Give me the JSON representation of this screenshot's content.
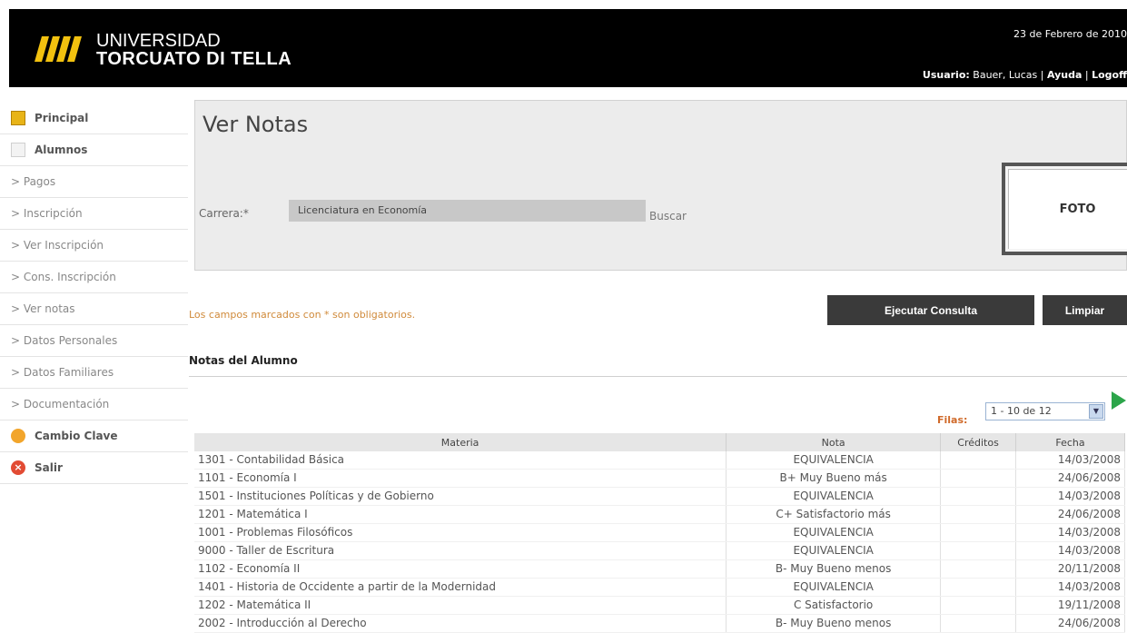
{
  "header": {
    "logo_line1": "UNIVERSIDAD",
    "logo_line2": "TORCUATO DI TELLA",
    "date": "23 de Febrero de 2010",
    "user_label": "Usuario:",
    "user_name": "Bauer, Lucas",
    "ayuda": "Ayuda",
    "logoff": "Logoff"
  },
  "sidebar": {
    "principal": "Principal",
    "alumnos": "Alumnos",
    "items": [
      "> Pagos",
      "> Inscripción",
      "> Ver Inscripción",
      "> Cons. Inscripción",
      "> Ver notas",
      "> Datos Personales",
      "> Datos Familiares",
      "> Documentación"
    ],
    "cambio_clave": "Cambio Clave",
    "salir": "Salir"
  },
  "form": {
    "title": "Ver Notas",
    "carrera_label": "Carrera:*",
    "carrera_value": "Licenciatura en Economía",
    "buscar": "Buscar",
    "foto": "FOTO",
    "required_note": "Los campos marcados con * son obligatorios.",
    "ejecutar": "Ejecutar Consulta",
    "limpiar": "Limpiar"
  },
  "results": {
    "section_title": "Notas del Alumno",
    "filas_label": "Filas:",
    "filas_value": "1 - 10 de 12",
    "columns": [
      "Materia",
      "Nota",
      "Créditos",
      "Fecha"
    ],
    "rows": [
      {
        "materia": "1301 - Contabilidad Básica",
        "nota": "EQUIVALENCIA",
        "creditos": "",
        "fecha": "14/03/2008"
      },
      {
        "materia": "1101 - Economía I",
        "nota": "B+ Muy Bueno más",
        "creditos": "",
        "fecha": "24/06/2008"
      },
      {
        "materia": "1501 - Instituciones Políticas y de Gobierno",
        "nota": "EQUIVALENCIA",
        "creditos": "",
        "fecha": "14/03/2008"
      },
      {
        "materia": "1201 - Matemática I",
        "nota": "C+ Satisfactorio más",
        "creditos": "",
        "fecha": "24/06/2008"
      },
      {
        "materia": "1001 - Problemas Filosóficos",
        "nota": "EQUIVALENCIA",
        "creditos": "",
        "fecha": "14/03/2008"
      },
      {
        "materia": "9000 - Taller de Escritura",
        "nota": "EQUIVALENCIA",
        "creditos": "",
        "fecha": "14/03/2008"
      },
      {
        "materia": "1102 - Economía II",
        "nota": "B- Muy Bueno menos",
        "creditos": "",
        "fecha": "20/11/2008"
      },
      {
        "materia": "1401 - Historia de Occidente a partir de la Modernidad",
        "nota": "EQUIVALENCIA",
        "creditos": "",
        "fecha": "14/03/2008"
      },
      {
        "materia": "1202 - Matemática II",
        "nota": "C Satisfactorio",
        "creditos": "",
        "fecha": "19/11/2008"
      },
      {
        "materia": "2002 - Introducción al Derecho",
        "nota": "B- Muy Bueno menos",
        "creditos": "",
        "fecha": "24/06/2008"
      }
    ]
  },
  "colors": {
    "header_bg": "#000000",
    "logo_yellow": "#f2c10f",
    "button_bg": "#3a3a3a",
    "note_orange": "#d08a3a"
  },
  "icons": {
    "next": "next-page-icon"
  }
}
